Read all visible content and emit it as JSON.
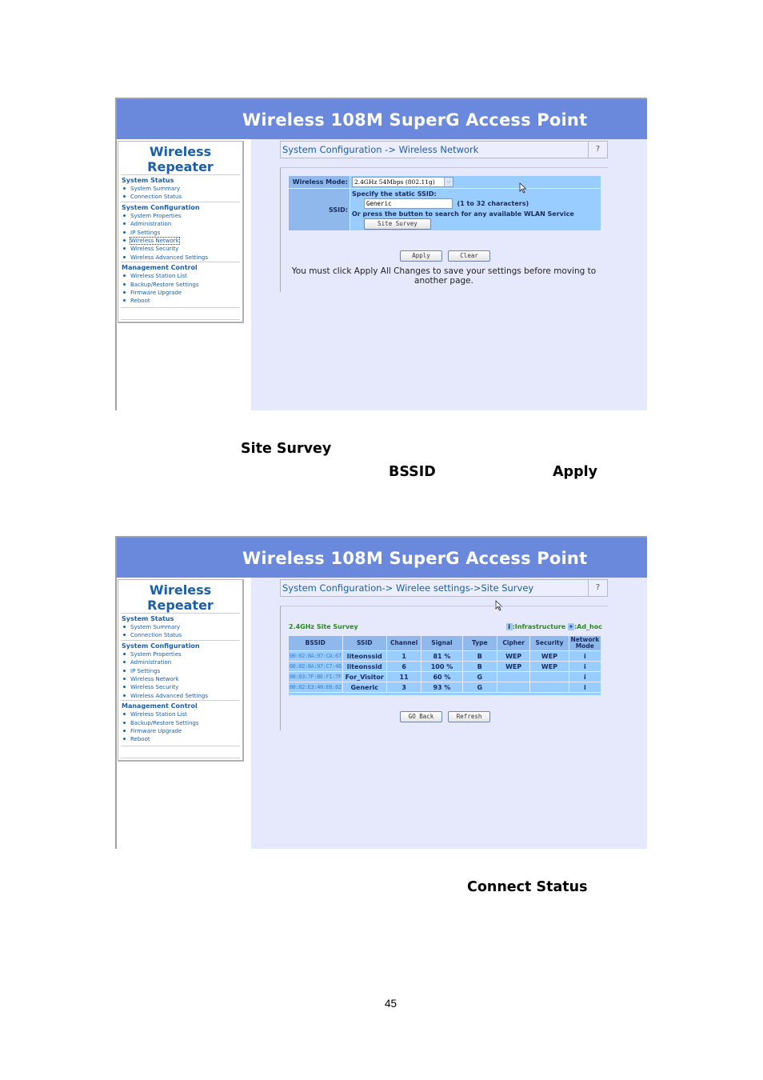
{
  "screenshot1": {
    "banner_title": "Wireless 108M SuperG Access Point",
    "brand_line1": "Wireless",
    "brand_line2": "Repeater",
    "nav": {
      "system_status": {
        "title": "System Status",
        "items": [
          "System Summary",
          "Connection Status"
        ]
      },
      "system_configuration": {
        "title": "System Configuration",
        "items": [
          "System Properties",
          "Administration",
          "IP Settings",
          "Wireless Network",
          "Wireless Security",
          "Wireless Advanced Settings"
        ]
      },
      "management_control": {
        "title": "Management Control",
        "items": [
          "Wireless Station List",
          "Backup/Restore Settings",
          "Firmware Upgrade",
          "Reboot"
        ]
      },
      "active_item": "Wireless Network"
    },
    "breadcrumb": "System Configuration -> Wireless Network",
    "help_label": "?",
    "form": {
      "wireless_mode_label": "Wireless Mode:",
      "wireless_mode_value": "2.4GHz 54Mbps (802.11g)",
      "ssid_label": "SSID:",
      "ssid_heading": "Specify the static SSID:",
      "ssid_value": "Generic",
      "ssid_hint": "(1 to 32 characters)",
      "search_hint": "Or press the button to search for any available WLAN Service",
      "site_survey_button": "Site Survey"
    },
    "apply_button": "Apply",
    "clear_button": "Clear",
    "note": "You must click Apply All Changes to save your settings before moving to another page."
  },
  "doc_text": {
    "site_survey": "Site Survey",
    "bssid": "BSSID",
    "apply": "Apply",
    "connect_status": "Connect Status",
    "page_number": "45"
  },
  "screenshot2": {
    "banner_title": "Wireless 108M SuperG Access Point",
    "brand_line1": "Wireless",
    "brand_line2": "Repeater",
    "breadcrumb": "System Configuration-> Wirelee settings->Site Survey",
    "help_label": "?",
    "survey_title": "2.4GHz Site Survey",
    "legend": {
      "infrastructure_icon": "i",
      "infrastructure_label": ":Infrastructure",
      "adhoc_icon": "✦",
      "adhoc_label": ":Ad_hoc"
    },
    "columns": [
      "BSSID",
      "SSID",
      "Channel",
      "Signal",
      "Type",
      "Cipher",
      "Security",
      "Network Mode"
    ],
    "rows": [
      {
        "bssid": "00:02:8A:97:CA:67",
        "ssid": "liteonssid",
        "channel": "1",
        "signal": "81 %",
        "type": "B",
        "cipher": "WEP",
        "security": "WEP",
        "mode": "i"
      },
      {
        "bssid": "00:02:8A:97:C7:46",
        "ssid": "liteonssid",
        "channel": "6",
        "signal": "100 %",
        "type": "B",
        "cipher": "WEP",
        "security": "WEP",
        "mode": "i"
      },
      {
        "bssid": "00:03:7F:BE:F1:7F",
        "ssid": "For_Visitor",
        "channel": "11",
        "signal": "60 %",
        "type": "G",
        "cipher": "",
        "security": "",
        "mode": "i"
      },
      {
        "bssid": "00:02:E3:40:E6:82",
        "ssid": "Generic",
        "channel": "3",
        "signal": "93 %",
        "type": "G",
        "cipher": "",
        "security": "",
        "mode": "i"
      }
    ],
    "go_back_button": "GO Back",
    "refresh_button": "Refresh"
  }
}
